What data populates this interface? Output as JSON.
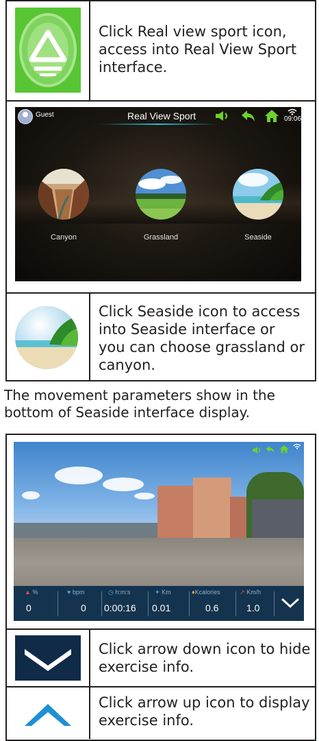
{
  "row1": {
    "app_icon": "real-view-sport-icon",
    "text": [
      "Click Real view sport icon,",
      "access into Real View Sport",
      "interface."
    ]
  },
  "screen1": {
    "guest": "Guest",
    "title": "Real View Sport",
    "time": "09:06",
    "scenes": [
      "Canyon",
      "Grassland",
      "Seaside"
    ]
  },
  "row2": {
    "text": [
      "Click Seaside icon to access",
      "into Seaside interface or",
      "you can choose grassland or",
      "canyon."
    ]
  },
  "note": [
    "The movement parameters show in the",
    "bottom of Seaside interface display."
  ],
  "screen2": {
    "stats": [
      {
        "label": "%",
        "value": "0",
        "icon": "incline-icon"
      },
      {
        "label": "bpm",
        "value": "0",
        "icon": "heart-icon"
      },
      {
        "label": "h:m:s",
        "value": "0:00:16",
        "icon": "clock-icon"
      },
      {
        "label": "Km",
        "value": "0.01",
        "icon": "footsteps-icon"
      },
      {
        "label": "Kcalories",
        "value": "0.6",
        "icon": "flame-icon"
      },
      {
        "label": "Km/h",
        "value": "1.0",
        "icon": "runner-icon"
      }
    ]
  },
  "row3": {
    "text": [
      "Click arrow down icon to hide",
      "exercise info."
    ]
  },
  "row4": {
    "text": [
      "Click arrow up icon to display",
      "exercise info."
    ]
  },
  "colors": {
    "border": "#231f20",
    "panel": "#14334e",
    "green": "#5bc23c",
    "accent": "#28bed2"
  }
}
